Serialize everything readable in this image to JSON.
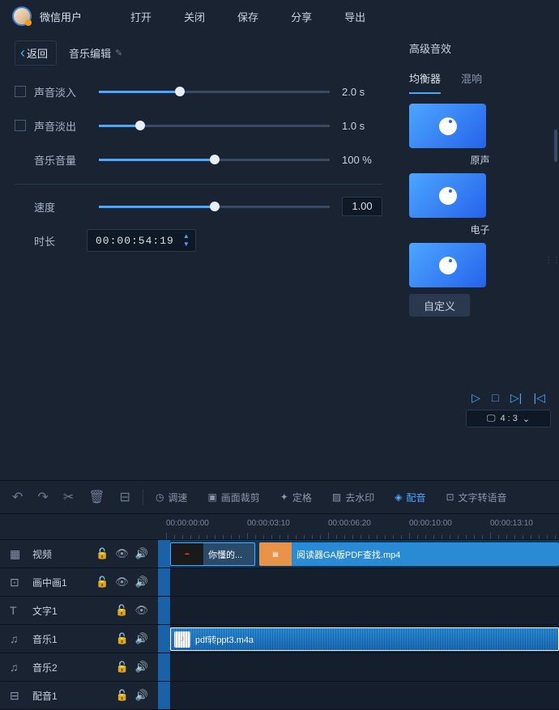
{
  "header": {
    "username": "微信用户",
    "menu": [
      "打开",
      "关闭",
      "保存",
      "分享",
      "导出"
    ]
  },
  "leftPanel": {
    "back": "返回",
    "title": "音乐编辑",
    "fadeIn": {
      "label": "声音淡入",
      "value": "2.0 s",
      "pos": 35
    },
    "fadeOut": {
      "label": "声音淡出",
      "value": "1.0 s",
      "pos": 18
    },
    "volume": {
      "label": "音乐音量",
      "value": "100 %",
      "pos": 50
    },
    "speed": {
      "label": "速度",
      "value": "1.00",
      "pos": 50
    },
    "duration": {
      "label": "时长",
      "value": "00:00:54:19"
    }
  },
  "rightPanel": {
    "title": "高级音效",
    "tabs": [
      "均衡器",
      "混响"
    ],
    "presets": [
      "原声",
      "电子",
      ""
    ],
    "customBtn": "自定义"
  },
  "playback": {
    "ratio": "4 : 3"
  },
  "toolbar": {
    "speed": "调速",
    "crop": "画面裁剪",
    "freeze": "定格",
    "watermark": "去水印",
    "dub": "配音",
    "tts": "文字转语音"
  },
  "timeline": {
    "marks": [
      "00:00:00:00",
      "00:00:03:10",
      "00:00:06:20",
      "00:00:10:00",
      "00:00:13:10"
    ],
    "tracks": [
      {
        "icon": "film",
        "name": "视频",
        "lock": true,
        "eye": true,
        "sound": true
      },
      {
        "icon": "pip",
        "name": "画中画1",
        "lock": true,
        "eye": true,
        "sound": true
      },
      {
        "icon": "text",
        "name": "文字1",
        "lock": true,
        "eye": true,
        "sound": false
      },
      {
        "icon": "music",
        "name": "音乐1",
        "lock": true,
        "eye": false,
        "sound": true
      },
      {
        "icon": "music",
        "name": "音乐2",
        "lock": true,
        "eye": false,
        "sound": true
      },
      {
        "icon": "dub",
        "name": "配音1",
        "lock": true,
        "eye": false,
        "sound": true
      }
    ],
    "clip1": "你懂的...",
    "clip2": "阅读器GA版PDF查找.mp4",
    "clip3": "pdf转ppt3.m4a"
  }
}
